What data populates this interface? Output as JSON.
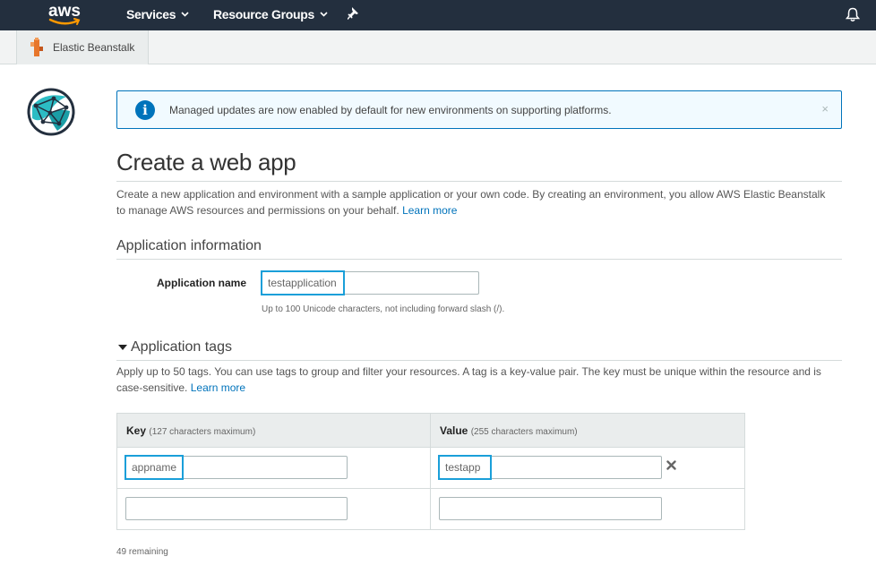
{
  "topnav": {
    "logo_text": "aws",
    "services_label": "Services",
    "resource_groups_label": "Resource Groups",
    "pin_icon": "pin-icon",
    "bell_icon": "bell-icon"
  },
  "service_bar": {
    "service_label": "Elastic Beanstalk"
  },
  "banner": {
    "message": "Managed updates are now enabled by default for new environments on supporting platforms.",
    "close_glyph": "×"
  },
  "page": {
    "title": "Create a web app",
    "description": "Create a new application and environment with a sample application or your own code. By creating an environment, you allow AWS Elastic Beanstalk to manage AWS resources and permissions on your behalf.",
    "learn_more": "Learn more"
  },
  "app_info": {
    "heading": "Application information",
    "name_label": "Application name",
    "name_value": "testapplication",
    "name_hint": "Up to 100 Unicode characters, not including forward slash (/)."
  },
  "tags": {
    "heading": "Application tags",
    "description": "Apply up to 50 tags. You can use tags to group and filter your resources. A tag is a key-value pair. The key must be unique within the resource and is case-sensitive.",
    "learn_more": "Learn more",
    "key_header": "Key",
    "key_sub": "(127 characters maximum)",
    "value_header": "Value",
    "value_sub": "(255 characters maximum)",
    "rows": [
      {
        "key": "appname",
        "value": "testapp"
      },
      {
        "key": "",
        "value": ""
      }
    ],
    "remaining": "49 remaining"
  },
  "colors": {
    "nav_bg": "#232f3e",
    "accent_blue": "#0073bb",
    "highlight": "#1a9fd9"
  }
}
